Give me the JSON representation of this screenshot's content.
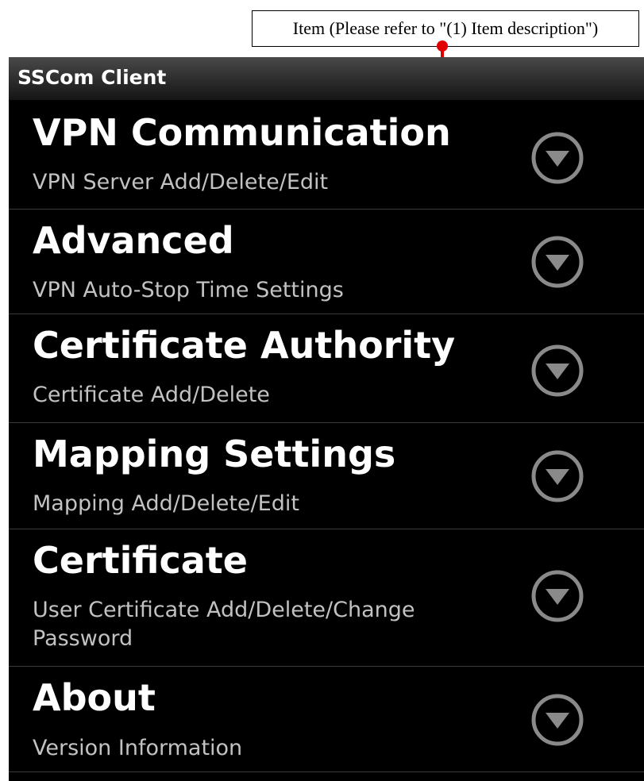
{
  "callout": {
    "text": "Item (Please refer to \"(1) Item description\")"
  },
  "app": {
    "title": "SSCom Client"
  },
  "items": [
    {
      "title": "VPN Communication",
      "subtitle": "VPN Server Add/Delete/Edit"
    },
    {
      "title": "Advanced",
      "subtitle": "VPN Auto-Stop Time Settings"
    },
    {
      "title": "Certificate Authority",
      "subtitle": "Certificate Add/Delete"
    },
    {
      "title": "Mapping Settings",
      "subtitle": "Mapping Add/Delete/Edit"
    },
    {
      "title": "Certificate",
      "subtitle": "User Certificate Add/Delete/Change Password"
    },
    {
      "title": "About",
      "subtitle": "Version Information"
    }
  ],
  "icons": {
    "expand": "chevron-down-circle-icon"
  },
  "colors": {
    "background": "#000000",
    "text": "#ffffff",
    "subtext": "#c2c2c2",
    "annotation_arrow": "#e00000"
  }
}
